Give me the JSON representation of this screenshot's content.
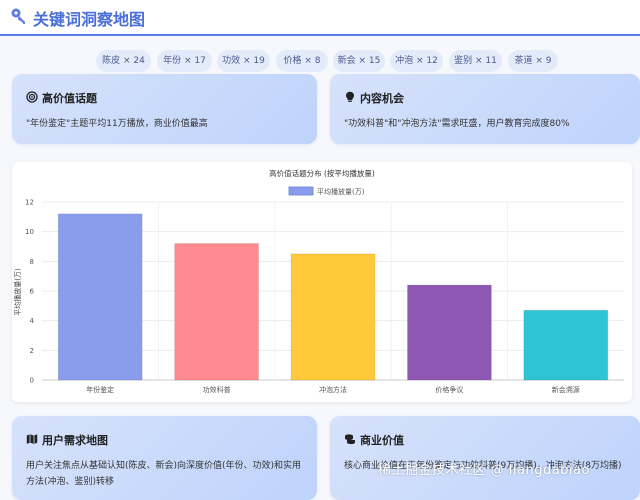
{
  "header": {
    "title": "关键词洞察地图",
    "icon": "key-icon"
  },
  "tags": [
    "陈皮 × 24",
    "年份 × 17",
    "功效 × 19",
    "价格 × 8",
    "新会 × 15",
    "冲泡 × 12",
    "鉴别 × 11",
    "茶道 × 9"
  ],
  "cards": {
    "high_value": {
      "icon": "target-icon",
      "title": "高价值话题",
      "text": "\"年份鉴定\"主题平均11万播放，商业价值最高"
    },
    "opportunity": {
      "icon": "lightbulb-icon",
      "title": "内容机会",
      "text": "\"功效科普\"和\"冲泡方法\"需求旺盛，用户教育完成度80%"
    },
    "demand_map": {
      "icon": "map-icon",
      "title": "用户需求地图",
      "text": "用户关注焦点从基础认知(陈皮、新会)向深度价值(年份、功效)和实用方法(冲泡、鉴别)转移"
    },
    "business": {
      "icon": "coins-icon",
      "title": "商业价值",
      "text": "核心商业价值在于年份鉴定与功效科普(9万均播)，冲泡方法(8万均播)"
    }
  },
  "chart_data": {
    "type": "bar",
    "title": "高价值话题分布 (按平均播放量)",
    "legend": "平均播放量(万)",
    "legend_position": "top-center",
    "ylabel": "平均播放量(万)",
    "xlabel": "",
    "ylim": [
      0,
      12
    ],
    "yticks": [
      0,
      2,
      4,
      6,
      8,
      10,
      12
    ],
    "grid": true,
    "categories": [
      "年份鉴定",
      "功效科普",
      "冲泡方法",
      "价格争议",
      "新会溯源"
    ],
    "values": [
      11.2,
      9.2,
      8.5,
      6.4,
      4.7
    ],
    "colors": [
      "#8a9ded",
      "#ff8a8f",
      "#ffc93a",
      "#8e57b3",
      "#2ec5d6"
    ],
    "legend_color": "#8a9ded"
  },
  "watermark": "稀土掘金技术社区 @ liangdabiao"
}
